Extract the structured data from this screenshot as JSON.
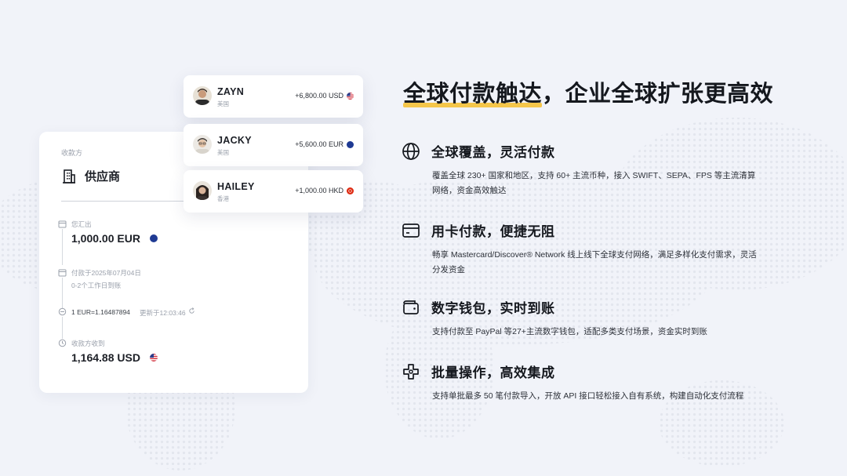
{
  "headline": {
    "highlight": "全球付款触达",
    "rest": "，企业全球扩张更高效"
  },
  "features": [
    {
      "icon": "globe-icon",
      "title": "全球覆盖，灵活付款",
      "desc": "覆盖全球 230+ 国家和地区，支持 60+ 主流币种，接入 SWIFT、SEPA、FPS 等主流清算网络，资金高效触达"
    },
    {
      "icon": "card-icon",
      "title": "用卡付款，便捷无阻",
      "desc": "畅享 Mastercard/Discover® Network 线上线下全球支付网络，满足多样化支付需求，灵活分发资金"
    },
    {
      "icon": "wallet-icon",
      "title": "数字钱包，实时到账",
      "desc": "支持付款至 PayPal 等27+主流数字钱包，适配多类支付场景，资金实时到账"
    },
    {
      "icon": "integration-icon",
      "title": "批量操作，高效集成",
      "desc": "支持单批最多 50 笔付款导入，开放 API 接口轻松接入自有系统，构建自动化支付流程"
    }
  ],
  "payment_card": {
    "receiver_label": "收款方",
    "receiver_type": "供应商",
    "send_label": "您汇出",
    "send_amount": "1,000.00 EUR",
    "paid_on": "付款于2025年07月04日",
    "eta": "0-2个工作日到账",
    "rate": "1 EUR=1.16487894",
    "rate_updated": "更新于12:03:46",
    "recv_label": "收款方收到",
    "recv_amount": "1,164.88 USD"
  },
  "recipients": [
    {
      "name": "ZAYN",
      "location": "美国",
      "amount": "+6,800.00 USD",
      "flag": "us-flag-icon"
    },
    {
      "name": "JACKY",
      "location": "美国",
      "amount": "+5,600.00 EUR",
      "flag": "eu-flag-icon"
    },
    {
      "name": "HAILEY",
      "location": "香港",
      "amount": "+1,000.00 HKD",
      "flag": "hk-flag-icon"
    }
  ],
  "colors": {
    "background": "#f1f3f9",
    "highlight": "#f5c64a",
    "eu_blue": "#1f3a93",
    "text_dark": "#15181e"
  }
}
